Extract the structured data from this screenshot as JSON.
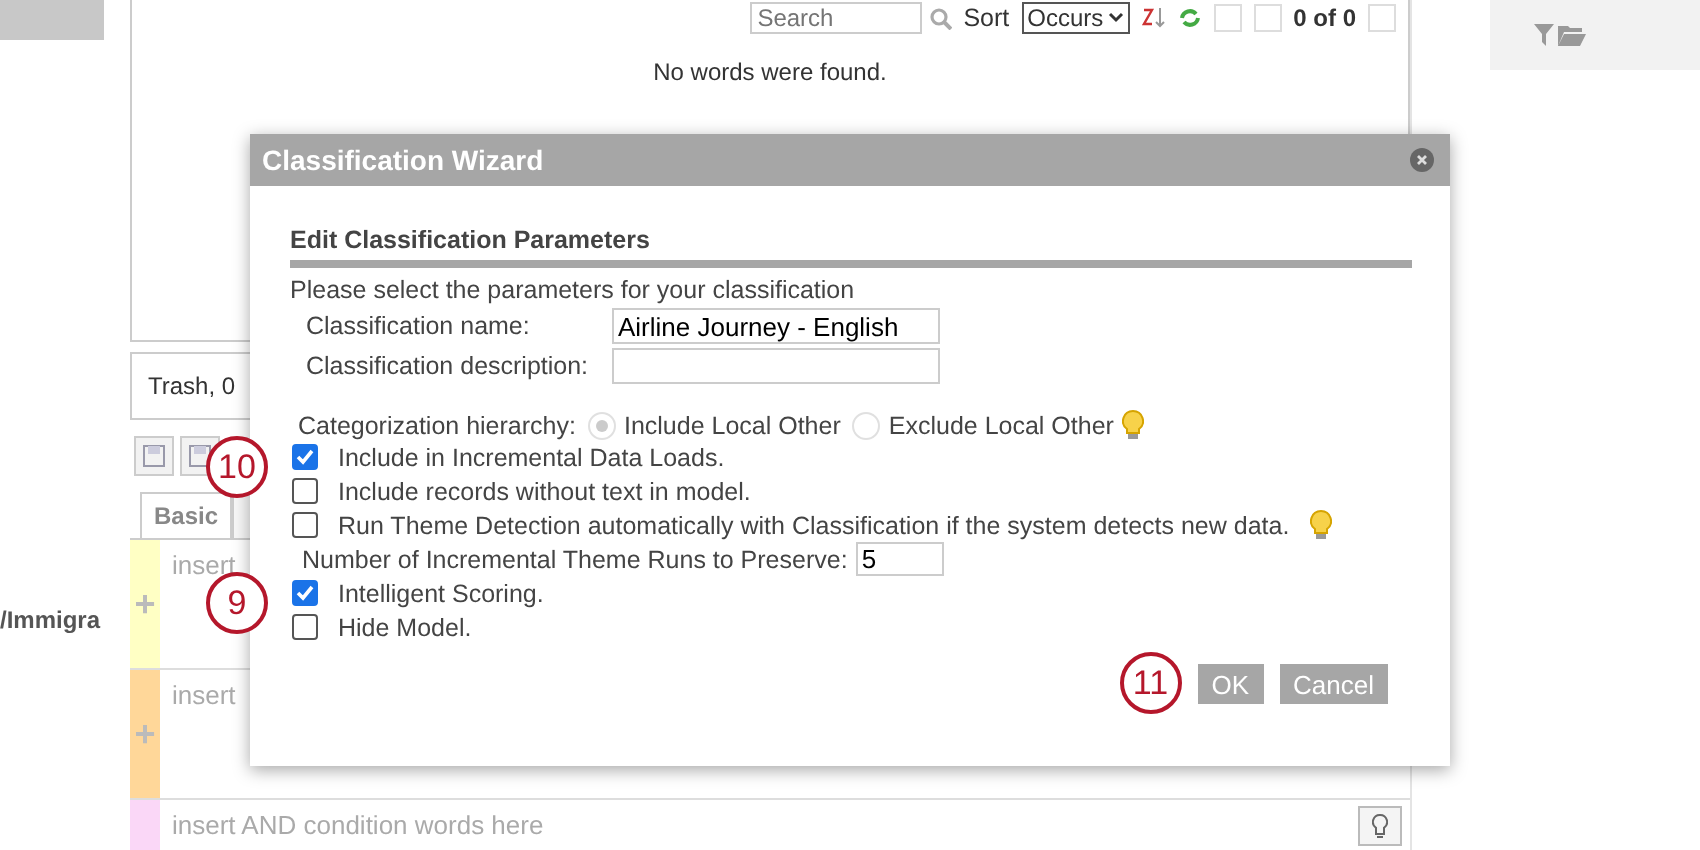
{
  "left_label": "/Immigra",
  "words_panel": {
    "search": {
      "placeholder": "Search"
    },
    "sort_label": "Sort",
    "sort_value": "Occurs",
    "pager": "0 of 0",
    "empty_message": "No words were found."
  },
  "trash_text": "Trash, 0",
  "tabs": [
    {
      "label": "Basic",
      "selected": true
    }
  ],
  "condition_rows": [
    {
      "placeholder": "insert",
      "color": "#ffffc4",
      "add_symbol": "+"
    },
    {
      "placeholder": "insert",
      "color": "#ffd799",
      "add_symbol": "+"
    },
    {
      "placeholder": "insert AND condition words here",
      "color": "#fad7f7"
    }
  ],
  "wizard": {
    "title": "Classification Wizard",
    "section_title": "Edit Classification Parameters",
    "intro": "Please select the parameters for your classification",
    "fields": [
      {
        "label": "Classification name:",
        "value": "Airline Journey - English"
      },
      {
        "label": "Classification description:"
      }
    ],
    "hierarchy": {
      "label": "Categorization hierarchy:",
      "hint": true,
      "options": [
        {
          "label": "Include Local Other",
          "selected": true,
          "disabled": true
        },
        {
          "label": "Exclude Local Other",
          "selected": false,
          "disabled": true
        }
      ]
    },
    "options": [
      {
        "kind": "checkbox",
        "label": "Include in Incremental Data Loads.",
        "checked": true,
        "callout": "10"
      },
      {
        "kind": "checkbox",
        "label": "Include records without text in model.",
        "checked": false
      },
      {
        "kind": "checkbox",
        "label": "Run Theme Detection automatically with Classification if the system detects new data.",
        "checked": false,
        "hint": true
      },
      {
        "kind": "number",
        "label": "Number of Incremental Theme Runs to Preserve:",
        "value": "5"
      },
      {
        "kind": "checkbox",
        "label": "Intelligent Scoring.",
        "checked": true,
        "callout": "9"
      },
      {
        "kind": "checkbox",
        "label": "Hide Model.",
        "checked": false
      }
    ],
    "buttons": [
      {
        "label": "OK",
        "callout": "11"
      },
      {
        "label": "Cancel"
      }
    ]
  }
}
